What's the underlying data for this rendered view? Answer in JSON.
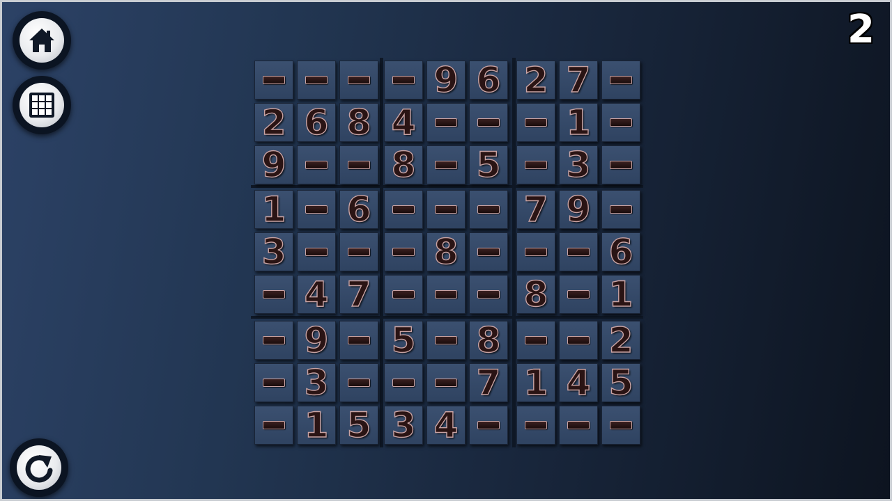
{
  "level": "2",
  "colors": {
    "background_left": "#2c4266",
    "background_right": "#0d1420",
    "cell": "#34496a",
    "digit": "#2a1414",
    "digit_outline": "#c9a3a3"
  },
  "buttons": {
    "home_icon": "home-icon",
    "levels_icon": "grid-icon",
    "reset_icon": "redo-icon"
  },
  "grid": [
    [
      "",
      "",
      "",
      "",
      "9",
      "6",
      "2",
      "7",
      ""
    ],
    [
      "2",
      "6",
      "8",
      "4",
      "",
      "",
      "",
      "1",
      ""
    ],
    [
      "9",
      "",
      "",
      "8",
      "",
      "5",
      "",
      "3",
      ""
    ],
    [
      "1",
      "",
      "6",
      "",
      "",
      "",
      "7",
      "9",
      ""
    ],
    [
      "3",
      "",
      "",
      "",
      "8",
      "",
      "",
      "",
      "6"
    ],
    [
      "",
      "4",
      "7",
      "",
      "",
      "",
      "8",
      "",
      "1"
    ],
    [
      "",
      "9",
      "",
      "5",
      "",
      "8",
      "",
      "",
      "2"
    ],
    [
      "",
      "3",
      "",
      "",
      "",
      "7",
      "1",
      "4",
      "5"
    ],
    [
      "",
      "1",
      "5",
      "3",
      "4",
      "",
      "",
      "",
      ""
    ]
  ]
}
